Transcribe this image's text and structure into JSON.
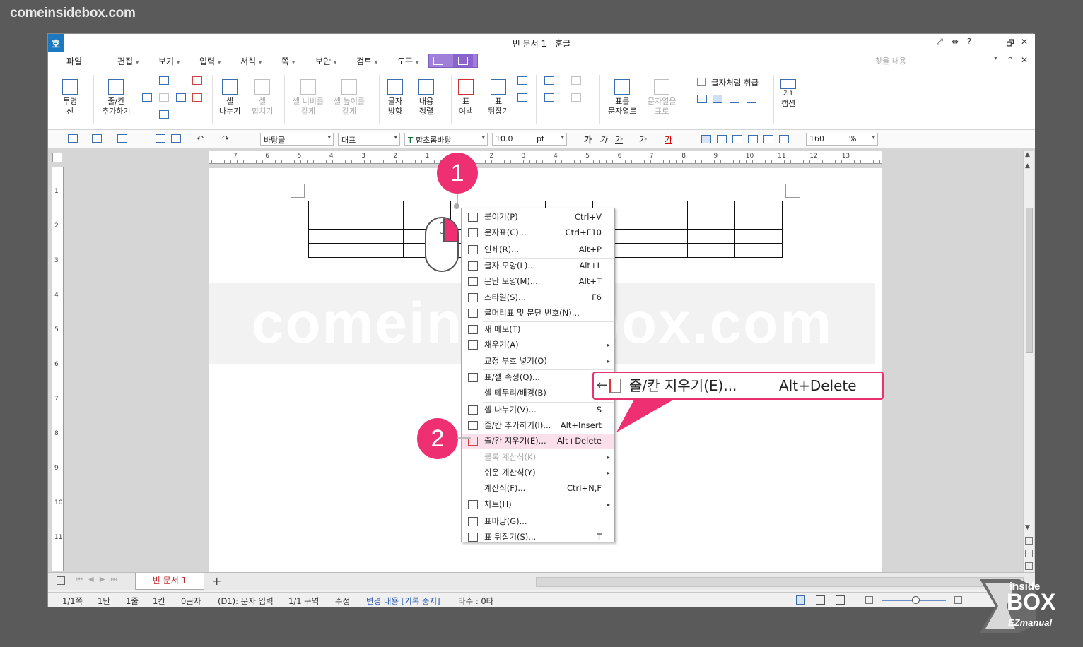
{
  "site_mark": "comeinsidebox.com",
  "window": {
    "app_icon": "호",
    "title": "빈 문서 1 - 훈글",
    "controls": {
      "restore_size": "⤢",
      "split": "⇹",
      "help": "?",
      "minimize": "—",
      "maximize": "🗗",
      "close": "✕",
      "ribbon_collapse": "⌃"
    }
  },
  "menu": {
    "items": [
      "파일",
      "편집",
      "보기",
      "입력",
      "서식",
      "쪽",
      "보안",
      "검토",
      "도구"
    ],
    "search_placeholder": "찾을 내용"
  },
  "ribbon": {
    "transparent_line": [
      "투명",
      "선"
    ],
    "add_row_col": [
      "줄/칸",
      "추가하기"
    ],
    "split_cell": [
      "셀",
      "나누기"
    ],
    "merge_cell": [
      "셀",
      "합치기"
    ],
    "same_width": [
      "셀 너비를",
      "같게"
    ],
    "same_height": [
      "셀 높이를",
      "같게"
    ],
    "text_direction": [
      "글자",
      "방향"
    ],
    "content_align": [
      "내용",
      "정렬"
    ],
    "table_margin": [
      "표",
      "여백"
    ],
    "table_flip": [
      "표",
      "뒤집기"
    ],
    "table_to_text": [
      "표를",
      "문자열로"
    ],
    "text_to_table": [
      "문자열을",
      "표로"
    ],
    "treat_as_char": "글자처럼 취급",
    "caption": "캡션",
    "caption_icon_label": "가1"
  },
  "toolbar": {
    "style": "바탕글",
    "language": "대표",
    "font": "함초롬바탕",
    "font_icon": "T",
    "size": "10.0",
    "size_unit": "pt",
    "format_buttons": [
      "가",
      "가",
      "가",
      "가",
      "가"
    ],
    "zoom": "160",
    "zoom_unit": "%"
  },
  "ruler_h_labels": [
    "7",
    "6",
    "5",
    "4",
    "3",
    "2",
    "1",
    "1",
    "2",
    "3",
    "4",
    "5",
    "6",
    "7",
    "8",
    "9",
    "10",
    "11",
    "12",
    "13"
  ],
  "ruler_v_labels": [
    "1",
    "2",
    "3",
    "4",
    "5",
    "6",
    "7",
    "8",
    "9",
    "10",
    "11"
  ],
  "watermark": "comeinsidebox.com",
  "markers": {
    "step1": "1",
    "step2": "2"
  },
  "context_menu": [
    {
      "label": "붙이기(P)",
      "shortcut": "Ctrl+V",
      "icon": "paste-icon"
    },
    {
      "label": "문자표(C)...",
      "shortcut": "Ctrl+F10",
      "icon": "symbol-icon"
    },
    {
      "label": "인쇄(R)...",
      "shortcut": "Alt+P",
      "icon": "print-icon"
    },
    {
      "label": "글자 모양(L)...",
      "shortcut": "Alt+L",
      "icon": "char-shape-icon"
    },
    {
      "label": "문단 모양(M)...",
      "shortcut": "Alt+T",
      "icon": "para-shape-icon"
    },
    {
      "label": "스타일(S)...",
      "shortcut": "F6",
      "icon": "style-icon"
    },
    {
      "label": "글머리표 및 문단 번호(N)...",
      "shortcut": "",
      "icon": "bullet-icon"
    },
    {
      "label": "새 메모(T)",
      "shortcut": "",
      "icon": "memo-icon"
    },
    {
      "label": "채우기(A)",
      "shortcut": "",
      "icon": "fill-icon",
      "submenu": true
    },
    {
      "label": "교정 부호 넣기(O)",
      "shortcut": "",
      "icon": "",
      "submenu": true
    },
    {
      "label": "표/셀 속성(Q)...",
      "shortcut": "",
      "icon": "table-props-icon"
    },
    {
      "label": "셀 테두리/배경(B)",
      "shortcut": "",
      "icon": ""
    },
    {
      "label": "셀 나누기(V)...",
      "shortcut": "S",
      "icon": "split-cell-icon"
    },
    {
      "label": "줄/칸 추가하기(I)...",
      "shortcut": "Alt+Insert",
      "icon": "add-rowcol-icon"
    },
    {
      "label": "줄/칸 지우기(E)...",
      "shortcut": "Alt+Delete",
      "icon": "delete-rowcol-icon",
      "highlight": true
    },
    {
      "label": "블록 계산식(K)",
      "shortcut": "",
      "icon": "",
      "submenu": true,
      "disabled": true
    },
    {
      "label": "쉬운 계산식(Y)",
      "shortcut": "",
      "icon": "",
      "submenu": true
    },
    {
      "label": "계산식(F)...",
      "shortcut": "Ctrl+N,F",
      "icon": ""
    },
    {
      "label": "차트(H)",
      "shortcut": "",
      "icon": "chart-icon",
      "submenu": true
    },
    {
      "label": "표마당(G)...",
      "shortcut": "",
      "icon": "table-template-icon"
    },
    {
      "label": "표 뒤집기(S)...",
      "shortcut": "T",
      "icon": "table-flip-icon"
    }
  ],
  "callout": {
    "label": "줄/칸 지우기(E)...",
    "shortcut": "Alt+Delete"
  },
  "tabs": {
    "doc": "빈 문서 1",
    "add": "+"
  },
  "status": [
    "1/1쪽",
    "1단",
    "1줄",
    "1칸",
    "0글자",
    "(D1): 문자 입력",
    "1/1 구역",
    "수정",
    "변경 내용 [기록 중지]",
    "타수 : 0타"
  ],
  "status_highlight_color": "#2a58b0",
  "accent_pink": "#ee2f72",
  "logo": {
    "line1": "inside",
    "line2": "BOX",
    "line3": "EZmanual"
  }
}
